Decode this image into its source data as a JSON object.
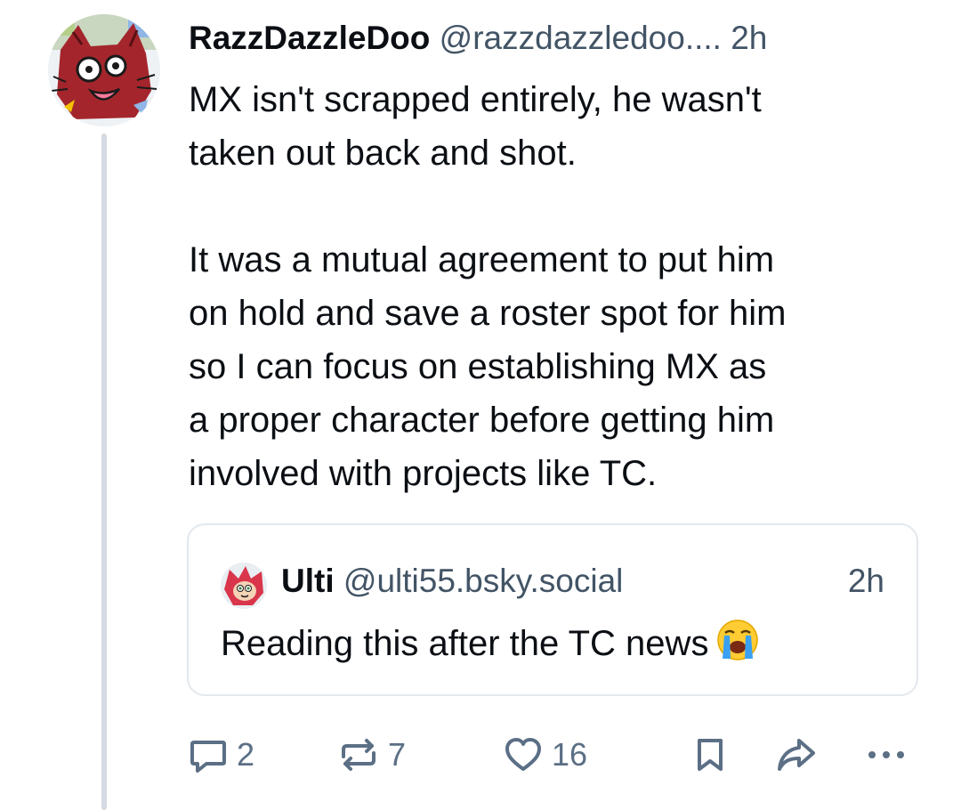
{
  "post": {
    "display_name": "RazzDazzleDoo",
    "handle": "@razzdazzledoo....",
    "time": "2h",
    "text": "MX isn't scrapped entirely, he wasn't\ntaken out back and shot.\n\nIt was a mutual agreement to put him\non hold and save a roster spot for him\nso I can focus on establishing MX as\na proper character before getting him\ninvolved with projects like TC.",
    "avatar_icon": "cartoon-cat-avatar"
  },
  "quote": {
    "display_name": "Ulti",
    "handle": "@ulti55.bsky.social",
    "time": "2h",
    "text": "Reading this after the TC news",
    "emoji": "crying-face-emoji",
    "avatar_icon": "cartoon-hedgehog-avatar"
  },
  "actions": {
    "reply_count": "2",
    "repost_count": "7",
    "like_count": "16",
    "reply_icon": "reply-icon",
    "repost_icon": "repost-icon",
    "like_icon": "heart-icon",
    "bookmark_icon": "bookmark-icon",
    "share_icon": "share-icon",
    "more_icon": "more-icon"
  },
  "colors": {
    "text": "#0b0f14",
    "muted": "#425466",
    "icon": "#5b6f85",
    "thread_line": "#d4dbe2",
    "card_border": "#e3e8ed"
  }
}
